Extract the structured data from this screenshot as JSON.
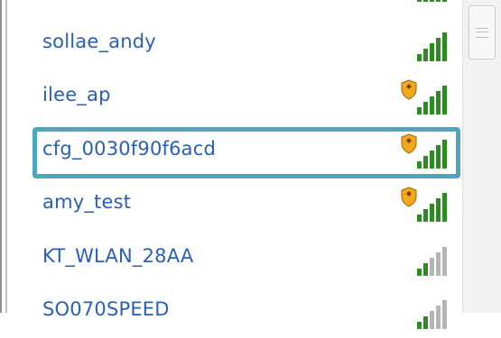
{
  "networks": [
    {
      "ssid": "sollae_andy",
      "secured": false,
      "strength": 5,
      "selected": false
    },
    {
      "ssid": "ilee_ap",
      "secured": true,
      "strength": 5,
      "selected": false
    },
    {
      "ssid": "cfg_0030f90f6acd",
      "secured": true,
      "strength": 5,
      "selected": true
    },
    {
      "ssid": "amy_test",
      "secured": true,
      "strength": 5,
      "selected": false
    },
    {
      "ssid": "KT_WLAN_28AA",
      "secured": false,
      "strength": 2,
      "selected": false
    },
    {
      "ssid": "SO070SPEED",
      "secured": false,
      "strength": 2,
      "selected": false
    }
  ],
  "colors": {
    "ssid_text": "#2a5fb3",
    "selection_border": "#4aa7bd",
    "signal_active": "#2e8b24",
    "signal_inactive": "#b5b5b5",
    "shield": "#f2a81d"
  },
  "icons": {
    "signal": "signal-strength-icon",
    "security": "security-shield-icon"
  }
}
